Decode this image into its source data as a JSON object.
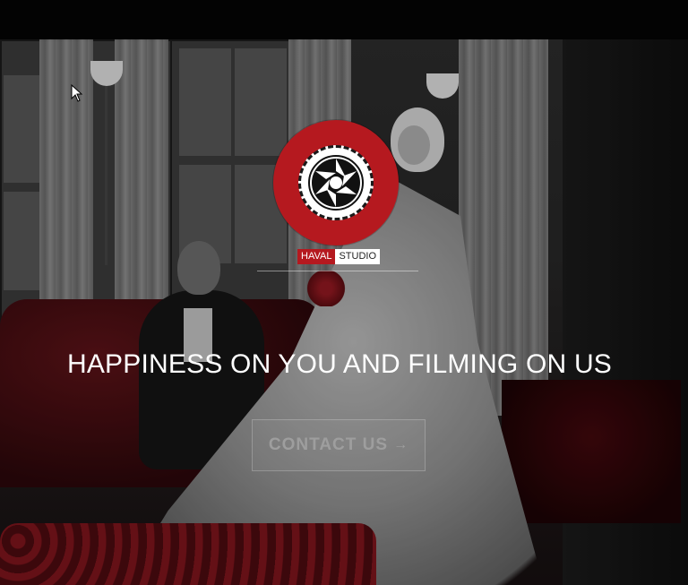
{
  "brand": {
    "logo_icon": "camera-aperture-icon",
    "name_part1": "HAVAL",
    "name_part2": "STUDIO",
    "colors": {
      "accent": "#b5191f",
      "text": "#ffffff"
    }
  },
  "hero": {
    "headline": "HAPPINESS ON YOU AND FILMING ON US",
    "cta_label": "CONTACT US",
    "cta_icon": "arrow-right-icon"
  }
}
